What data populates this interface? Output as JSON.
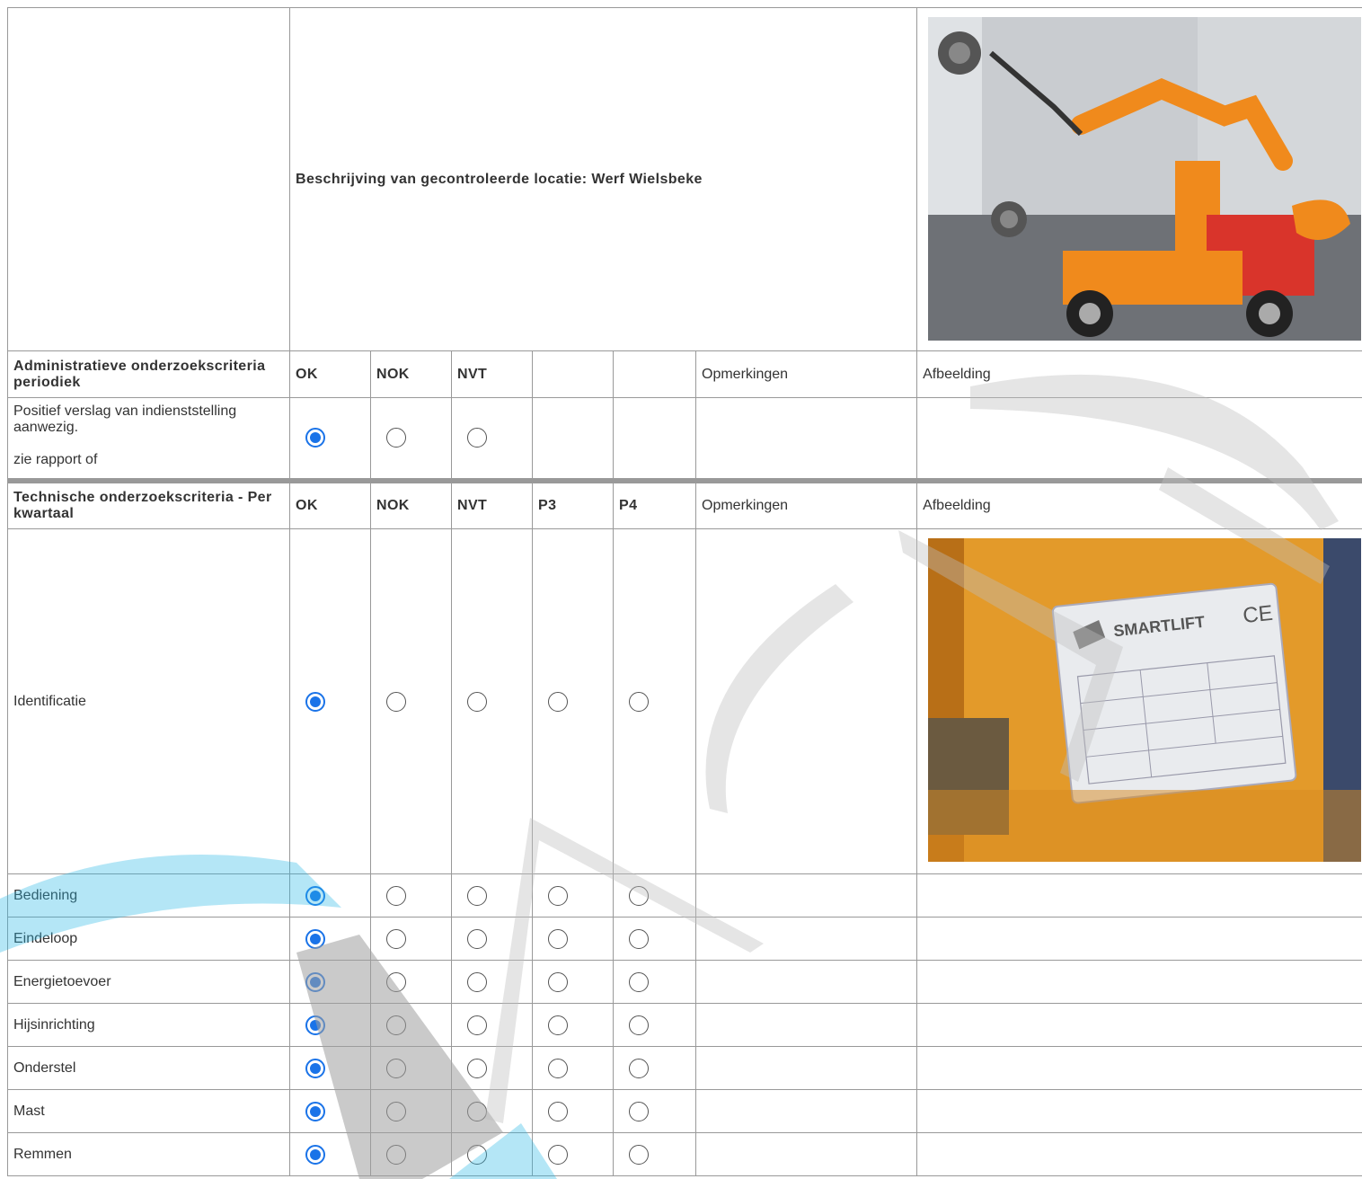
{
  "location": {
    "description": "Beschrijving van gecontroleerde locatie: Werf Wielsbeke"
  },
  "admin_section": {
    "title": "Administratieve onderzoekscriteria periodiek",
    "cols": {
      "ok": "OK",
      "nok": "NOK",
      "nvt": "NVT",
      "opmerkingen": "Opmerkingen",
      "afbeelding": "Afbeelding"
    },
    "row": {
      "line1": "Positief verslag van indienststelling aanwezig.",
      "line2": "zie rapport of",
      "selected": "OK"
    }
  },
  "tech_section": {
    "title": "Technische onderzoekscriteria - Per kwartaal",
    "cols": {
      "ok": "OK",
      "nok": "NOK",
      "nvt": "NVT",
      "p3": "P3",
      "p4": "P4",
      "opmerkingen": "Opmerkingen",
      "afbeelding": "Afbeelding"
    },
    "rows": [
      {
        "label": "Identificatie",
        "selected": "OK"
      },
      {
        "label": "Bediening",
        "selected": "OK"
      },
      {
        "label": "Eindeloop",
        "selected": "OK"
      },
      {
        "label": "Energietoevoer",
        "selected": "OK"
      },
      {
        "label": "Hijsinrichting",
        "selected": "OK"
      },
      {
        "label": "Onderstel",
        "selected": "OK"
      },
      {
        "label": "Mast",
        "selected": "OK"
      },
      {
        "label": "Remmen",
        "selected": "OK"
      }
    ]
  },
  "plate": {
    "brand": "SMARTLIFT",
    "mark": "CE"
  },
  "colors": {
    "radio_selected": "#1a73e8",
    "border": "#999999",
    "watermark_blue": "#29b6e6",
    "watermark_gray": "#bdbdbd"
  }
}
